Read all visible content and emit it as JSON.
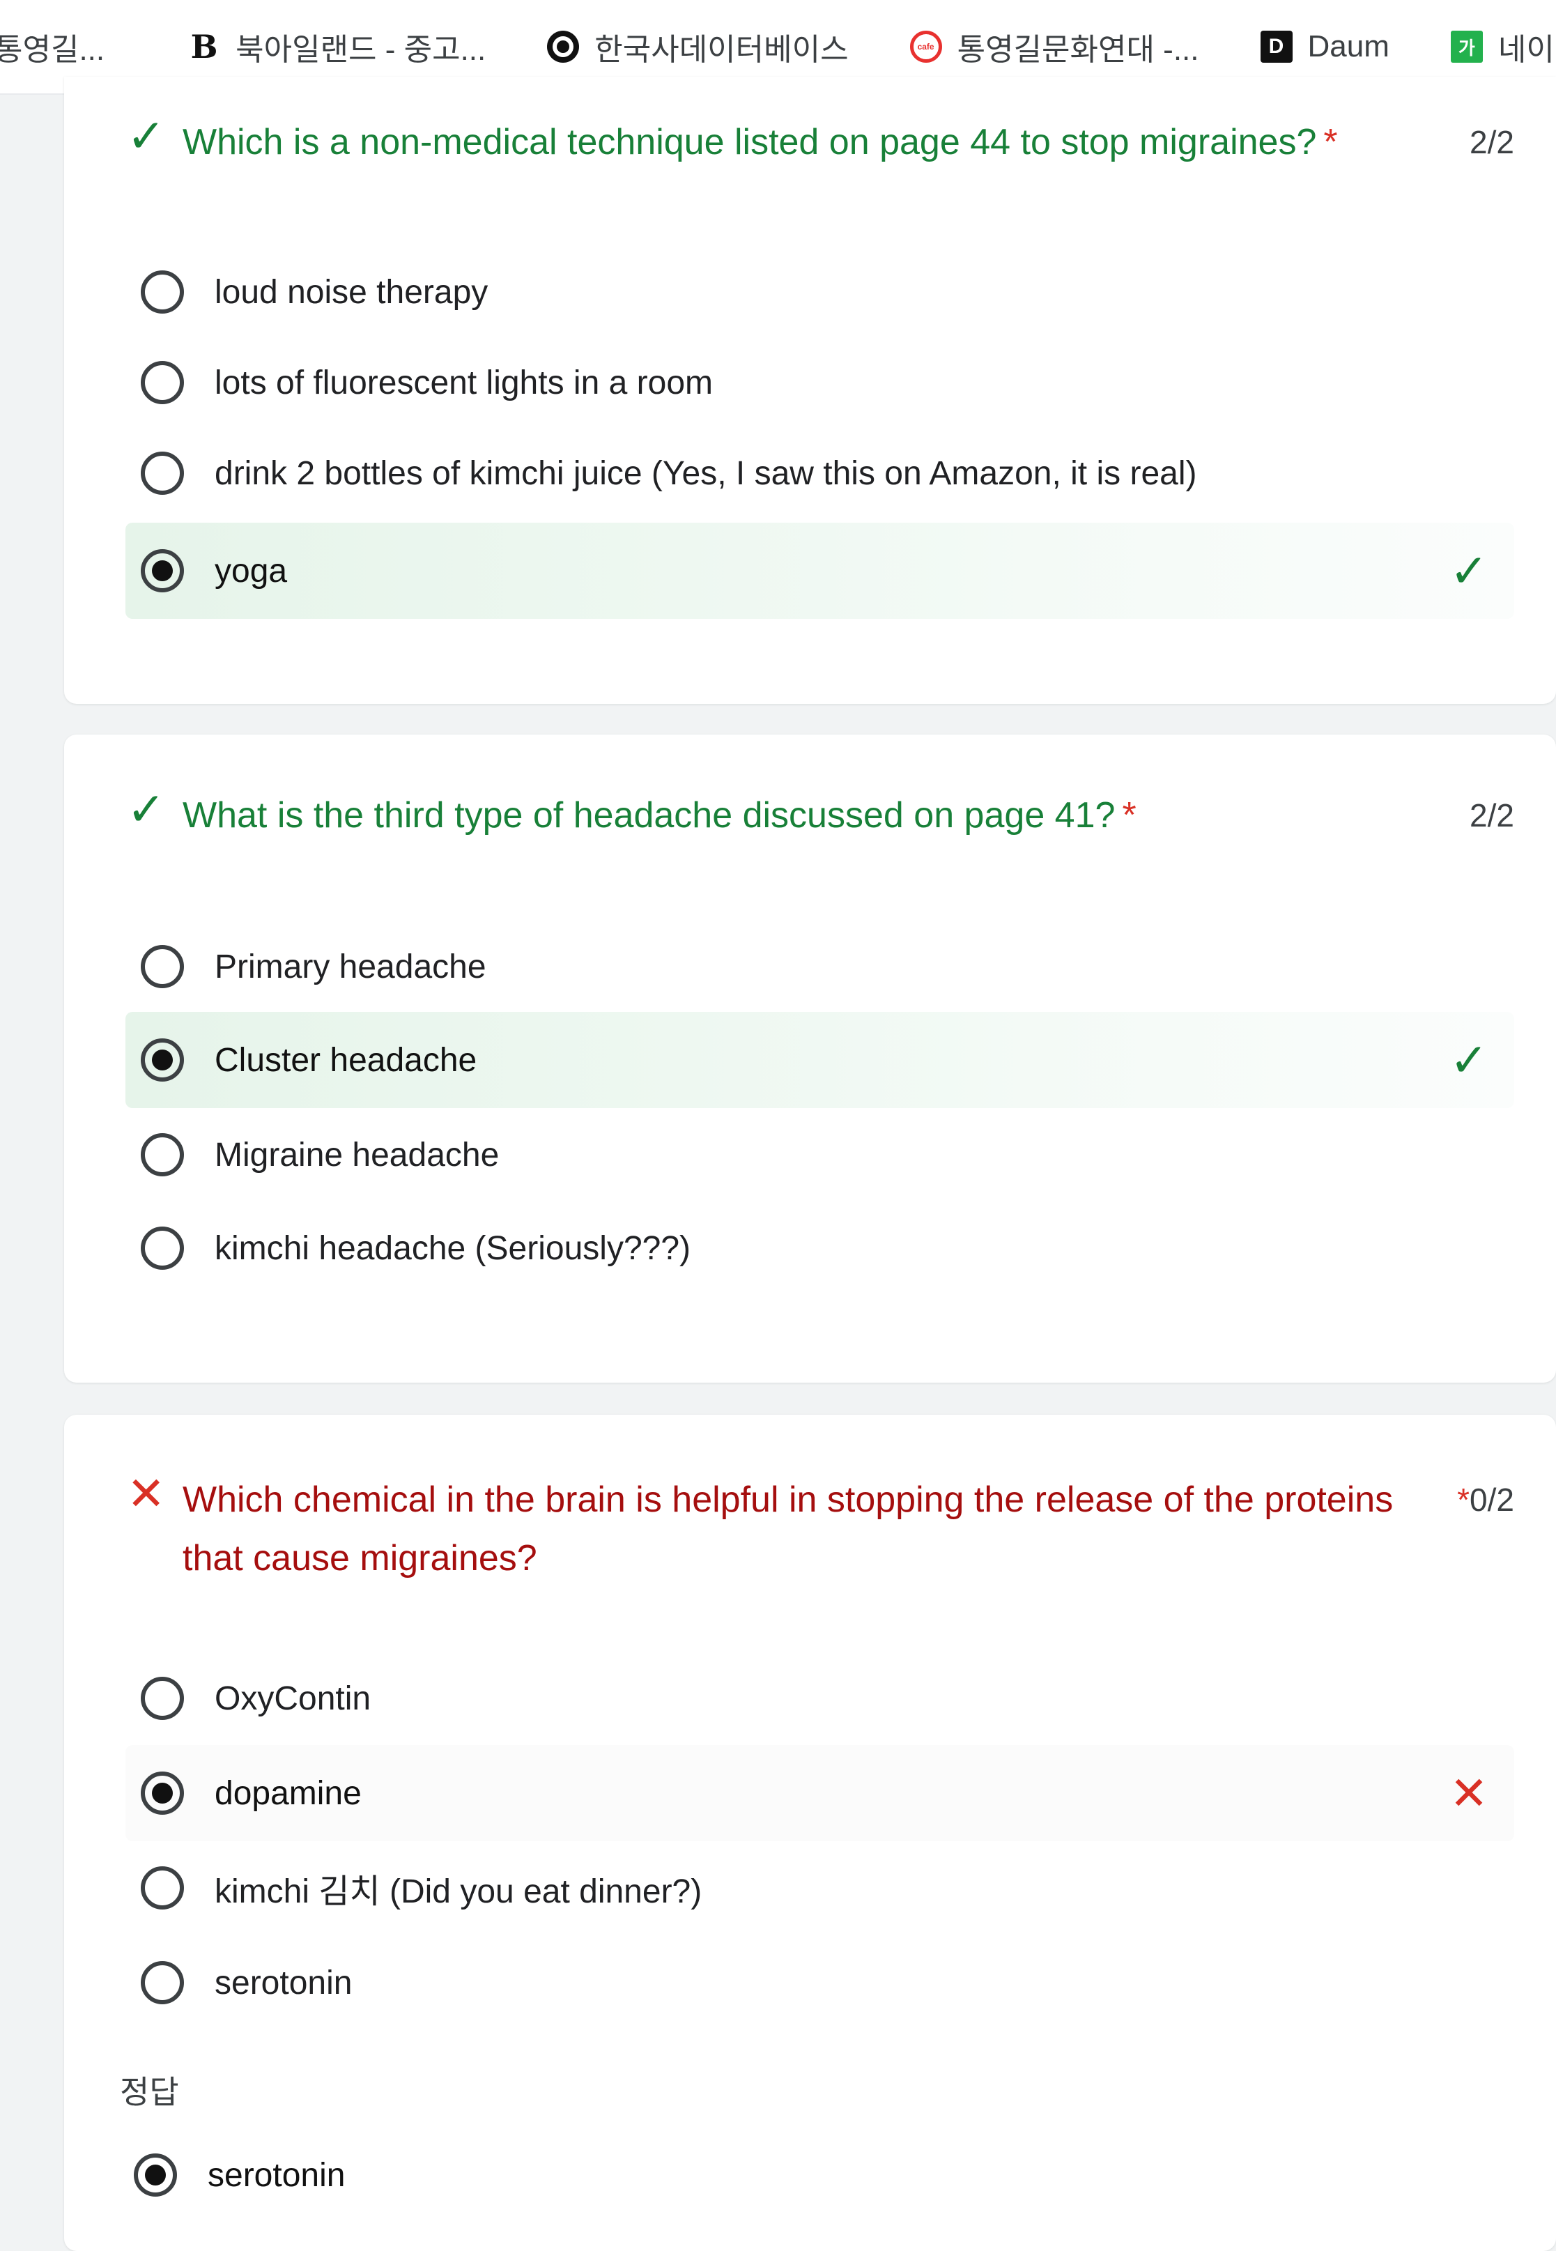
{
  "bookmarks": [
    {
      "label": "통영길...",
      "icon": "none"
    },
    {
      "label": "북아일랜드 - 중고...",
      "icon": "b-icon",
      "glyph": "B"
    },
    {
      "label": "한국사데이터베이스",
      "icon": "korea-emblem-icon",
      "glyph": ""
    },
    {
      "label": "통영길문화연대 -...",
      "icon": "cafe-icon",
      "glyph": "cafe"
    },
    {
      "label": "Daum",
      "icon": "daum-icon",
      "glyph": "D"
    },
    {
      "label": "네이",
      "icon": "naver-icon",
      "glyph": "가"
    }
  ],
  "questions": [
    {
      "status": "correct",
      "title": "Which is a non-medical technique listed on page 44 to stop migraines?",
      "required": "*",
      "score": "2/2",
      "options": [
        {
          "label": "loud noise therapy",
          "selected": false
        },
        {
          "label": "lots of fluorescent lights in a room",
          "selected": false
        },
        {
          "label": "drink 2 bottles of kimchi juice (Yes, I saw this on Amazon, it is real)",
          "selected": false
        },
        {
          "label": "yoga",
          "selected": true,
          "mark": "correct"
        }
      ]
    },
    {
      "status": "correct",
      "title": "What is the third type of headache discussed on page 41?",
      "required": "*",
      "score": "2/2",
      "options": [
        {
          "label": "Primary headache",
          "selected": false
        },
        {
          "label": "Cluster headache",
          "selected": true,
          "mark": "correct"
        },
        {
          "label": "Migraine headache",
          "selected": false
        },
        {
          "label": "kimchi headache (Seriously???)",
          "selected": false
        }
      ]
    },
    {
      "status": "incorrect",
      "title": "Which chemical in the brain is helpful in stopping the release of the proteins that cause migraines?",
      "required": "*",
      "score": "0/2",
      "options": [
        {
          "label": "OxyContin",
          "selected": false
        },
        {
          "label": "dopamine",
          "selected": true,
          "mark": "incorrect"
        },
        {
          "label": "kimchi 김치 (Did you eat dinner?)",
          "selected": false
        },
        {
          "label": "serotonin",
          "selected": false
        }
      ],
      "answer_label": "정답",
      "answer": "serotonin"
    }
  ],
  "glyphs": {
    "check": "✓",
    "cross": "✕"
  },
  "colors": {
    "correct": "#188038",
    "incorrect": "#d93025",
    "incorrect_title": "#a50e0e"
  }
}
